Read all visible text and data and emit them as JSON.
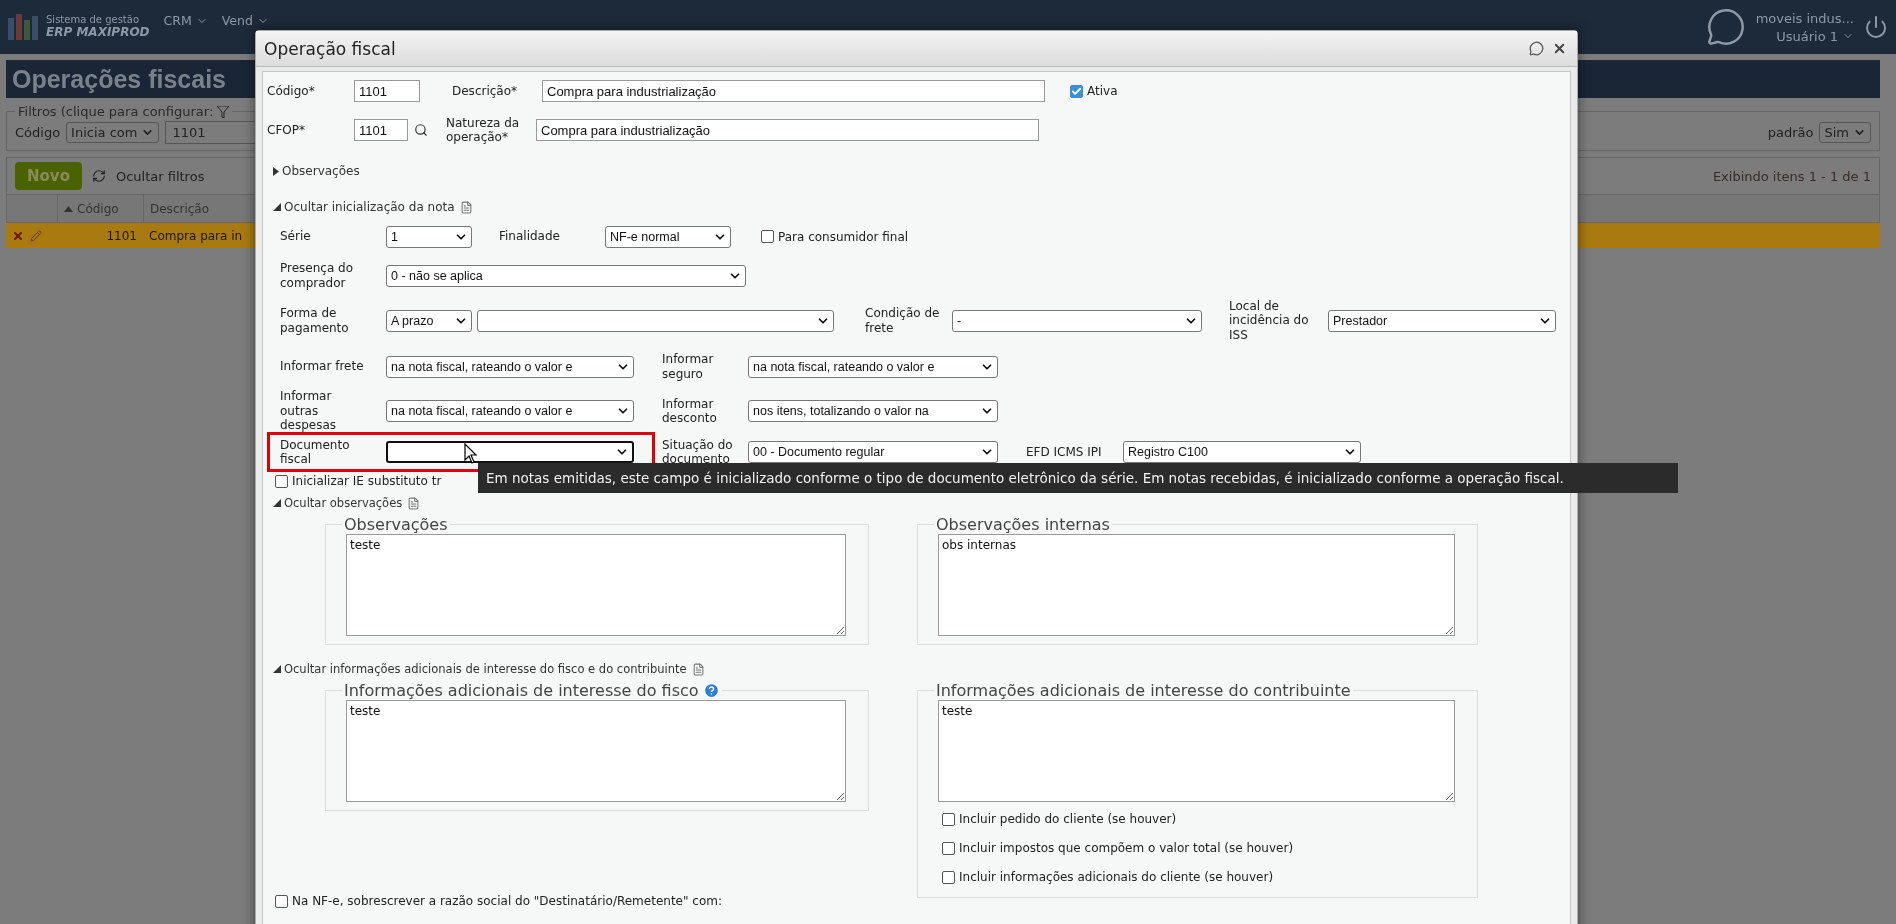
{
  "app": {
    "brand_line1": "Sistema de gestão",
    "brand_line2": "ERP MAXIPROD",
    "menu": [
      {
        "label": "CRM"
      },
      {
        "label": "Vend"
      }
    ],
    "company": "moveis indus...",
    "user": "Usuário 1"
  },
  "page": {
    "title": "Operações fiscais",
    "filter_legend": "Filtros (clique para configurar:",
    "filter_field": "Código",
    "filter_operator": "Inicia com",
    "filter_value": "1101",
    "default_label": "padrão",
    "default_value": "Sim",
    "new_button": "Novo",
    "hide_filters": "Ocultar filtros",
    "pagination": "Exibindo itens 1 - 1 de 1",
    "columns": [
      {
        "label": "Código",
        "sorted": true
      },
      {
        "label": "Descrição",
        "sorted": false
      }
    ],
    "rows": [
      {
        "code": "1101",
        "description": "Compra para in",
        "selected": true
      }
    ]
  },
  "dialog": {
    "title": "Operação fiscal",
    "code_label": "Código*",
    "code": "1101",
    "description_label": "Descrição*",
    "description": "Compra para industrialização",
    "active": {
      "label": "Ativa",
      "checked": true
    },
    "cfop_label": "CFOP*",
    "cfop": "1101",
    "nature_label": "Natureza da operação*",
    "nature": "Compra para industrialização",
    "observations_toggle": {
      "label": "Observações",
      "expanded": false
    },
    "init_section": {
      "label": "Ocultar inicialização da nota",
      "expanded": true,
      "rows": [
        {
          "fields": [
            {
              "kind": "select",
              "label": "Série",
              "value": "1",
              "highlighted": false
            },
            {
              "kind": "select",
              "label": "Finalidade",
              "value": "NF-e normal",
              "highlighted": false
            },
            {
              "kind": "checkbox",
              "label": "Para consumidor final",
              "checked": false
            }
          ]
        },
        {
          "fields": [
            {
              "kind": "select",
              "label": "Presença do comprador",
              "value": "0 - não se aplica",
              "highlighted": false
            }
          ]
        },
        {
          "fields": [
            {
              "kind": "select",
              "label": "Forma de pagamento",
              "value": "A prazo",
              "highlighted": false
            },
            {
              "kind": "select",
              "highlighted": false
            },
            {
              "kind": "select",
              "label": "Condição de frete",
              "value": "-",
              "highlighted": false
            },
            {
              "kind": "select",
              "label": "Local de incidência do ISS",
              "value": "Prestador",
              "highlighted": false
            }
          ]
        },
        {
          "fields": [
            {
              "kind": "select",
              "label": "Informar frete",
              "value": "na nota fiscal, rateando o valor e",
              "highlighted": false
            },
            {
              "kind": "select",
              "label": "Informar seguro",
              "value": "na nota fiscal, rateando o valor e",
              "highlighted": false
            }
          ]
        },
        {
          "fields": [
            {
              "kind": "select",
              "label": "Informar outras despesas",
              "value": "na nota fiscal, rateando o valor e",
              "highlighted": false
            },
            {
              "kind": "select",
              "label": "Informar desconto",
              "value": "nos itens, totalizando o valor na",
              "highlighted": false
            }
          ]
        },
        {
          "fields": [
            {
              "kind": "select",
              "label": "Documento fiscal",
              "highlighted": true
            },
            {
              "kind": "select",
              "label": "Situação do documento",
              "value": "00 - Documento regular",
              "highlighted": false
            },
            {
              "kind": "select",
              "label": "EFD ICMS IPI",
              "value": "Registro C100",
              "highlighted": false
            }
          ]
        }
      ]
    },
    "ie_option": {
      "label": "Inicializar IE substituto tr",
      "checked": false
    },
    "tooltip": {
      "text": "Em notas emitidas, este campo é inicializado conforme o tipo de documento eletrônico da série. Em notas recebidas, é inicializado conforme a operação fiscal."
    },
    "obs_section": {
      "label": "Ocultar observações",
      "expanded": true,
      "boxes": [
        {
          "legend": "Observações",
          "value": "teste",
          "help": false
        },
        {
          "legend": "Observações internas",
          "value": "obs internas",
          "help": false
        }
      ]
    },
    "info_section": {
      "label": "Ocultar informações adicionais de interesse do fisco e do contribuinte",
      "expanded": true,
      "boxes": [
        {
          "legend": "Informações adicionais de interesse do fisco",
          "value": "teste",
          "help": true
        },
        {
          "legend": "Informações adicionais de interesse do contribuinte",
          "value": "teste",
          "help": false,
          "options": [
            {
              "label": "Incluir pedido do cliente (se houver)",
              "checked": false
            },
            {
              "label": "Incluir impostos que compõem o valor total (se houver)",
              "checked": false
            },
            {
              "label": "Incluir informações adicionais do cliente (se houver)",
              "checked": false
            }
          ]
        }
      ]
    },
    "override_option": {
      "label": "Na NF-e, sobrescrever a razão social do \"Destinatário/Remetente\" com:",
      "checked": false
    }
  }
}
